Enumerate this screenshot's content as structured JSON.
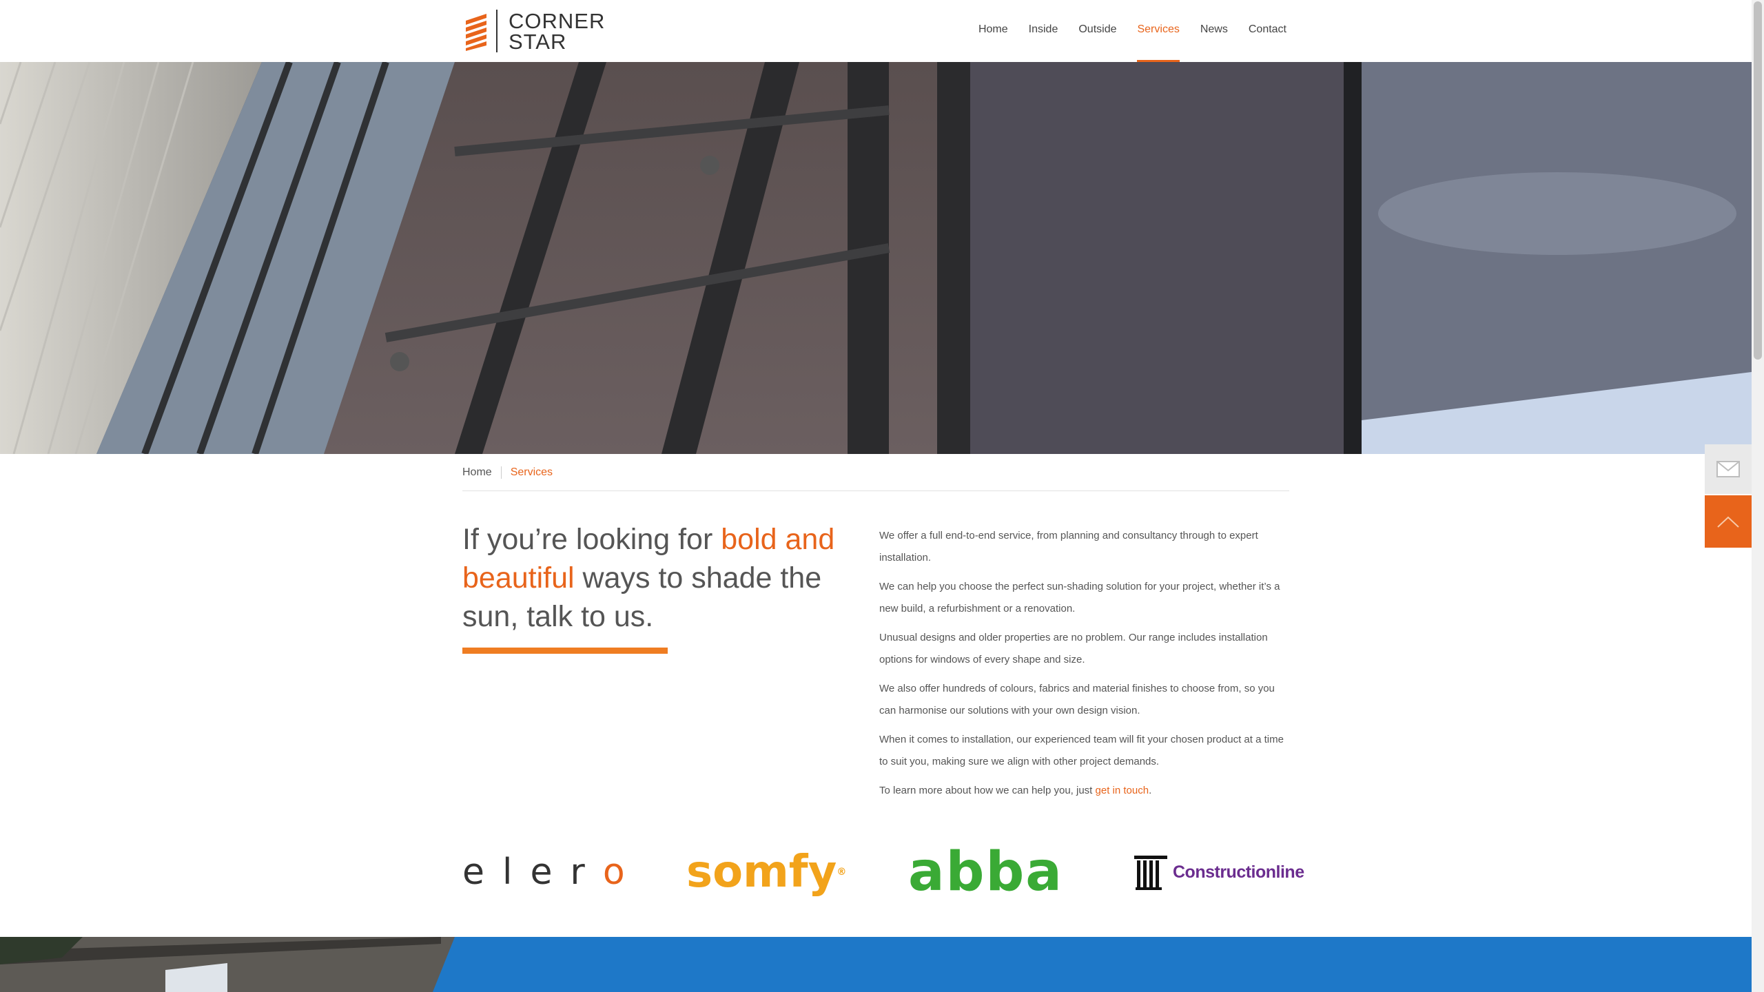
{
  "brand": {
    "line1": "CORNER",
    "line2": "STAR",
    "accent": "#e8641b"
  },
  "nav": [
    {
      "label": "Home"
    },
    {
      "label": "Inside"
    },
    {
      "label": "Outside"
    },
    {
      "label": "Services",
      "active": true
    },
    {
      "label": "News"
    },
    {
      "label": "Contact"
    }
  ],
  "breadcrumb": {
    "home": "Home",
    "current": "Services"
  },
  "intro": {
    "headline_a": "If you’re looking for ",
    "headline_hl": "bold and beautiful",
    "headline_b": " ways to shade the sun, talk to us."
  },
  "body": {
    "p1": "We offer a full end-to-end service, from planning and consultancy through to expert installation.",
    "p2": "We can help you choose the perfect sun-shading solution for your project, whether it’s a new build, a refurbishment or a renovation.",
    "p3": "Unusual designs and older properties are no problem. Our range includes installation options for windows of every shape and size.",
    "p4": "We also offer hundreds of colours, fabrics and material finishes to choose from, so you can harmonise our solutions with your own design vision.",
    "p5": "When it comes to installation, our experienced team will fit your chosen product at a time to suit you, making sure we align with other project demands.",
    "p6_prefix": "To learn more about how we can help you, just ",
    "p6_link": "get in touch",
    "p6_suffix": "."
  },
  "partners": {
    "elero_a": "eler",
    "elero_b": "o",
    "somfy": "somfy",
    "somfy_mark": "®",
    "abba": "abba",
    "constructionline": "Constructionline"
  },
  "icons": {
    "mail": "mail-icon",
    "scroll_top": "chevron-up-icon"
  },
  "colors": {
    "accent": "#e8641b",
    "band_blue": "#1e78c8"
  }
}
